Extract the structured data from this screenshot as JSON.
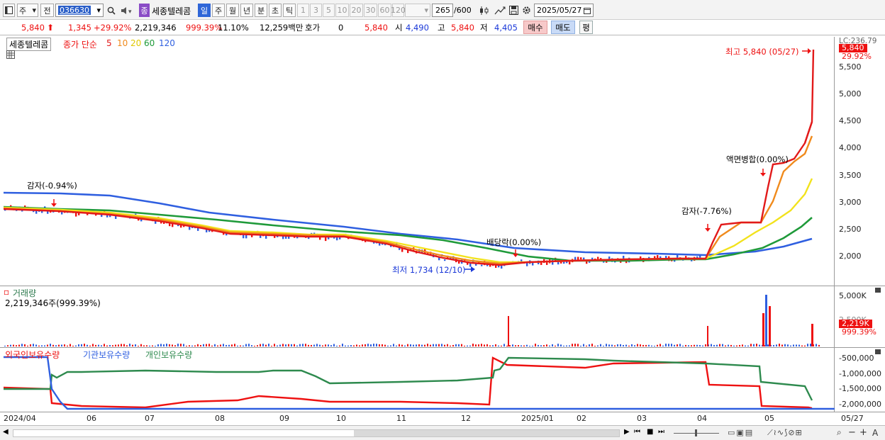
{
  "toolbar": {
    "market": "주",
    "prev": "전",
    "code": "036630",
    "company_badge": "종",
    "company_name": "세종텔레콤",
    "periods": [
      "일",
      "주",
      "월",
      "년",
      "분",
      "초",
      "틱"
    ],
    "selected_period": "일",
    "intervals": [
      "1",
      "3",
      "5",
      "10",
      "20",
      "30",
      "60",
      "120"
    ],
    "count": "265",
    "count_max": "/600",
    "date": "2025/05/27"
  },
  "quote": {
    "price": "5,840",
    "change": "1,345",
    "change_pct": "+29.92%",
    "volume": "2,219,346",
    "volume_pct": "999.39%",
    "turnover_pct": "11.10%",
    "amount": "12,259백만",
    "hoga_label": "호가",
    "hoga_value": "0",
    "bid": "5,840",
    "open_label": "시",
    "open": "4,490",
    "high_label": "고",
    "high": "5,840",
    "low_label": "저",
    "low": "4,405",
    "buy_btn": "매수",
    "sell_btn": "매도",
    "avg_btn": "평"
  },
  "price_panel": {
    "company": "세종텔레콤",
    "legend_prefix": "종가 단순",
    "ma_periods": [
      "5",
      "10",
      "20",
      "60",
      "120"
    ],
    "ma_colors": [
      "#e21a1a",
      "#f08a1c",
      "#f2e21c",
      "#1f9a3a",
      "#2f5fe0"
    ],
    "right_header": "LC:236.79",
    "current_price_flag": "5,840",
    "current_pct_flag": "29.92%",
    "ticks": [
      "5,500",
      "5,000",
      "4,500",
      "4,000",
      "3,500",
      "3,000",
      "2,500",
      "2,000"
    ],
    "annotations": {
      "high": "최고 5,840 (05/27)",
      "low": "최저 1,734 (12/10)",
      "capital_reduction_1": "감자(-0.94%)",
      "capital_reduction_2": "감자(-7.76%)",
      "dividend": "배당락(0.00%)",
      "split": "액면병합(0.00%)"
    }
  },
  "volume_panel": {
    "title": "거래량",
    "value_line": "2,219,346주(999.39%)",
    "ticks": [
      "5,000K",
      "2,500K"
    ],
    "current_flag": "2,219K",
    "current_pct_flag": "999.39%"
  },
  "holdings_panel": {
    "series": [
      "외국인보유수량",
      "기관보유수량",
      "개인보유수량"
    ],
    "series_colors": [
      "#e11",
      "#2f5fe0",
      "#2e8a4e"
    ],
    "ticks": [
      "-500,000",
      "-1,000,000",
      "-1,500,000",
      "-2,000,000"
    ]
  },
  "x_axis": {
    "labels": [
      "2024/04",
      "06",
      "07",
      "08",
      "09",
      "10",
      "11",
      "12",
      "2025/01",
      "02",
      "03",
      "04",
      "05",
      "05/27"
    ]
  }
}
